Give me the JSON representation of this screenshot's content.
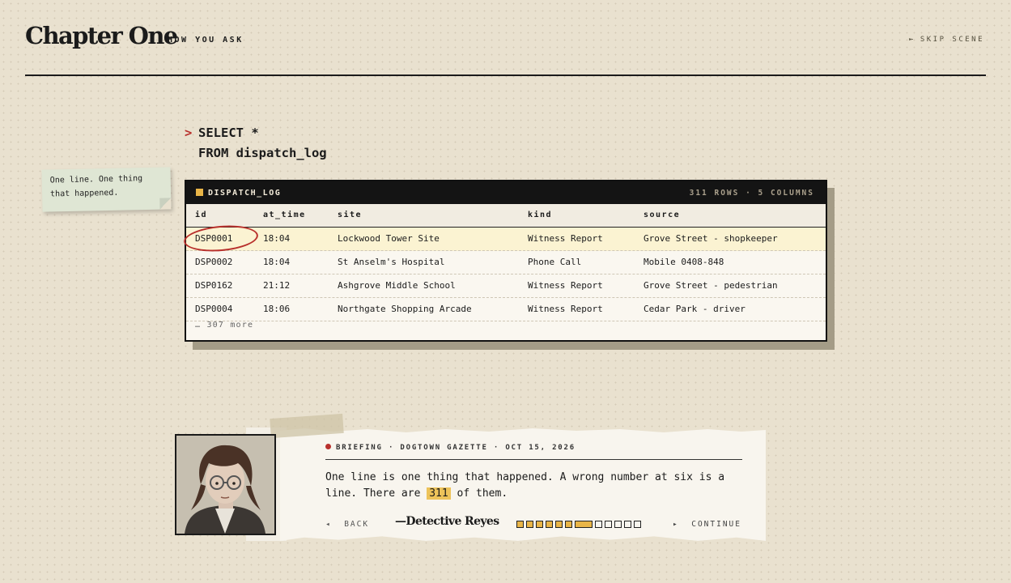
{
  "header": {
    "title": "Chapter One",
    "subtitle": "HOW YOU ASK",
    "skip_label": "SKIP SCENE",
    "skip_icon": "skip-back-arrow-icon"
  },
  "query": {
    "prompt": ">",
    "line1": "SELECT *",
    "line2": "FROM dispatch_log"
  },
  "sticky_note": {
    "text": "One line. One thing that happened."
  },
  "table": {
    "name": "DISPATCH_LOG",
    "meta": "311 ROWS · 5 COLUMNS",
    "columns": [
      "id",
      "at_time",
      "site",
      "kind",
      "source"
    ],
    "rows": [
      [
        "DSP0001",
        "18:04",
        "Lockwood Tower Site",
        "Witness Report",
        "Grove Street - shopkeeper"
      ],
      [
        "DSP0002",
        "18:04",
        "St Anselm's Hospital",
        "Phone Call",
        "Mobile 0408-848"
      ],
      [
        "DSP0162",
        "21:12",
        "Ashgrove Middle School",
        "Witness Report",
        "Grove Street - pedestrian"
      ],
      [
        "DSP0004",
        "18:06",
        "Northgate Shopping Arcade",
        "Witness Report",
        "Cedar Park - driver"
      ]
    ],
    "more": "… 307 more",
    "highlight_color": "#fbf3d2",
    "circle_color": "#b8302c"
  },
  "briefing": {
    "label": "BRIEFING",
    "source": "DOGTOWN GAZETTE",
    "date": "OCT 15, 2026",
    "sep": "·",
    "text_before": "One line is one thing that happened. A wrong number at six is a line. There are ",
    "highlight": "311",
    "text_after": " of them.",
    "back_label": "BACK",
    "continue_label": "CONTINUE",
    "signature": "—Detective Reyes",
    "progress": {
      "total": 12,
      "current": 7
    }
  },
  "colors": {
    "accent_red": "#b8302c",
    "accent_yellow": "#e9b547",
    "background": "#e9e1cf"
  }
}
